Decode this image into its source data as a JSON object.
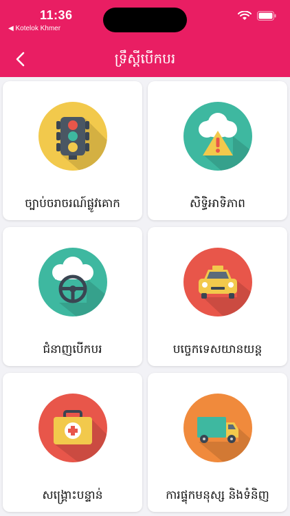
{
  "status_bar": {
    "time": "11:36",
    "back_app": "◀ Kotelok Khmer"
  },
  "header": {
    "title": "ទ្រឹស្តីបើកបរ"
  },
  "menu": [
    {
      "label": "ច្បាប់ចរាចរណ៍ផ្លូវគោក",
      "icon": "traffic-light-icon"
    },
    {
      "label": "សិទ្ធិអាទិភាព",
      "icon": "cloud-warning-icon"
    },
    {
      "label": "ជំនាញបើកបរ",
      "icon": "steering-wheel-icon"
    },
    {
      "label": "បច្ចេកទេសយានយន្ត",
      "icon": "taxi-car-icon"
    },
    {
      "label": "សង្គ្រោះបន្ទាន់",
      "icon": "first-aid-kit-icon"
    },
    {
      "label": "ការផ្ទុកមនុស្ស និងទំនិញ",
      "icon": "delivery-truck-icon"
    }
  ],
  "colors": {
    "header": "#e91e63",
    "traffic": "#f2c94c",
    "teal": "#3eb8a0",
    "red": "#e8564a",
    "orange": "#f08a3c"
  }
}
